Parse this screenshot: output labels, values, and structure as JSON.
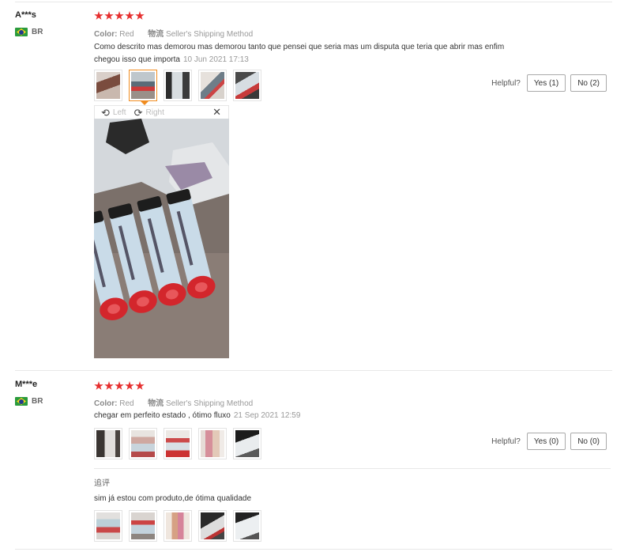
{
  "reviews": [
    {
      "user": "A***s",
      "country": "BR",
      "rating": 5,
      "color_label": "Color:",
      "color_value": "Red",
      "shipping_label": "物流",
      "shipping_value": "Seller's Shipping Method",
      "text_line1": "Como descrito mas demorou mas demorou tanto que pensei que seria mas um disputa que teria que abrir mas enfim",
      "text_line2": "chegou isso que importa",
      "date": "10 Jun 2021 17:13",
      "helpful_label": "Helpful?",
      "yes_label": "Yes (1)",
      "no_label": "No (2)",
      "viewer": {
        "left_label": "Left",
        "right_label": "Right"
      }
    },
    {
      "user": "M***e",
      "country": "BR",
      "rating": 5,
      "color_label": "Color:",
      "color_value": "Red",
      "shipping_label": "物流",
      "shipping_value": "Seller's Shipping Method",
      "text_line1": "chegar em perfeito estado , ótimo fluxo",
      "date": "21 Sep 2021 12:59",
      "helpful_label": "Helpful?",
      "yes_label": "Yes (0)",
      "no_label": "No (0)",
      "followup_label": "追评",
      "followup_text": "sim já estou com produto,de ótima qualidade"
    }
  ],
  "colors": {
    "star": "#e62e2e",
    "active_thumb": "#f08c20",
    "flag_green": "#2a9b3c"
  },
  "icons": {
    "rotate_left": "rotate-left-icon",
    "rotate_right": "rotate-right-icon",
    "close": "close-icon"
  }
}
